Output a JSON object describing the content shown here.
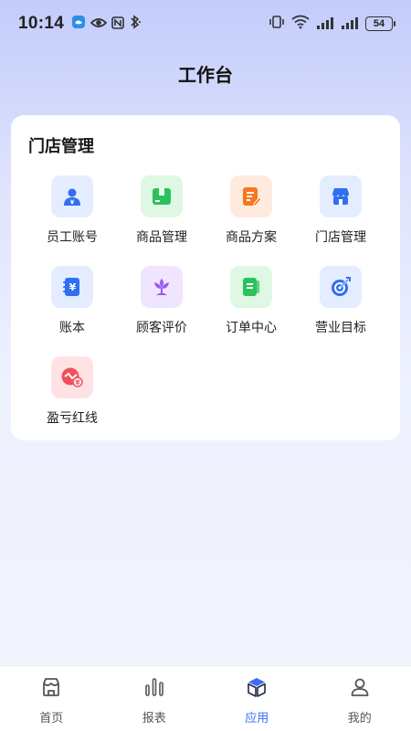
{
  "status_bar": {
    "time": "10:14",
    "battery": "54"
  },
  "header": {
    "title": "工作台"
  },
  "store_section": {
    "title": "门店管理",
    "items": [
      {
        "label": "员工账号",
        "icon": "staff-account-icon",
        "color": "#2f6ff2",
        "bg": "#e4ecff"
      },
      {
        "label": "商品管理",
        "icon": "product-box-icon",
        "color": "#2bc25c",
        "bg": "#def8e4"
      },
      {
        "label": "商品方案",
        "icon": "product-plan-icon",
        "color": "#f5781f",
        "bg": "#ffeadd"
      },
      {
        "label": "门店管理",
        "icon": "store-icon",
        "color": "#2f6ff2",
        "bg": "#e4ecff"
      },
      {
        "label": "账本",
        "icon": "ledger-icon",
        "color": "#2f6ff2",
        "bg": "#e4ecff"
      },
      {
        "label": "顾客评价",
        "icon": "flower-review-icon",
        "color": "#9a5bf2",
        "bg": "#efe5ff"
      },
      {
        "label": "订单中心",
        "icon": "order-book-icon",
        "color": "#2bc25c",
        "bg": "#def8e4"
      },
      {
        "label": "营业目标",
        "icon": "target-icon",
        "color": "#2f6ff2",
        "bg": "#e4ecff"
      },
      {
        "label": "盈亏红线",
        "icon": "profit-loss-icon",
        "color": "#f0505a",
        "bg": "#ffe3e4"
      }
    ]
  },
  "tabbar": {
    "tabs": [
      {
        "label": "首页",
        "icon": "home-store-icon"
      },
      {
        "label": "报表",
        "icon": "report-bars-icon"
      },
      {
        "label": "应用",
        "icon": "apps-cube-icon",
        "active": true
      },
      {
        "label": "我的",
        "icon": "profile-icon"
      }
    ],
    "active_color": "#3b6cf6"
  }
}
